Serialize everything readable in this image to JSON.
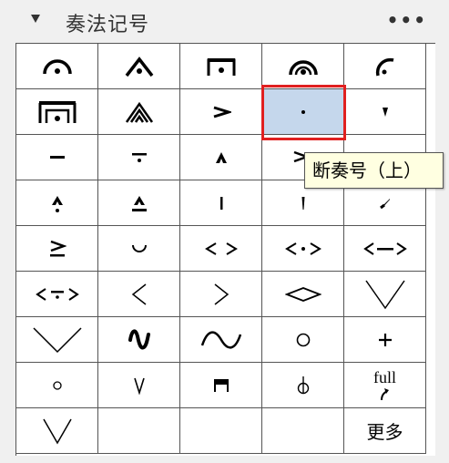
{
  "panel": {
    "title": "奏法记号",
    "more_menu": "•••"
  },
  "grid_cells": [
    {
      "name": "fermata-icon"
    },
    {
      "name": "fermata-triangle-icon"
    },
    {
      "name": "fermata-square-icon"
    },
    {
      "name": "fermata-long-icon"
    },
    {
      "name": "fermata-short-icon"
    },
    {
      "name": "fermata-very-long-icon"
    },
    {
      "name": "fermata-double-triangle-icon"
    },
    {
      "name": "accent-icon"
    },
    {
      "name": "staccato-icon",
      "selected": true
    },
    {
      "name": "staccatissimo-wedge-icon"
    },
    {
      "name": "tenuto-icon"
    },
    {
      "name": "tenuto-staccato-icon"
    },
    {
      "name": "marcato-icon"
    },
    {
      "name": "accent-staccato-icon"
    },
    {
      "name": "accent-small-icon"
    },
    {
      "name": "marcato-staccato-icon"
    },
    {
      "name": "marcato-tenuto-icon"
    },
    {
      "name": "staccatissimo-stroke-icon"
    },
    {
      "name": "staccatissimo-small-icon"
    },
    {
      "name": "staccatissimo-slash-icon"
    },
    {
      "name": "accent-tenuto-icon"
    },
    {
      "name": "breve-icon"
    },
    {
      "name": "messa-di-voce-icon"
    },
    {
      "name": "messa-di-voce-dot-icon"
    },
    {
      "name": "messa-di-voce-line-icon"
    },
    {
      "name": "messa-di-voce-tenuto-icon"
    },
    {
      "name": "crescendo-icon"
    },
    {
      "name": "decrescendo-icon"
    },
    {
      "name": "diamond-dynamics-icon"
    },
    {
      "name": "decrescendo-large-icon"
    },
    {
      "name": "crescendo-large-icon"
    },
    {
      "name": "vibrato-icon"
    },
    {
      "name": "wave-icon"
    },
    {
      "name": "harmonic-circle-icon"
    },
    {
      "name": "stopped-plus-icon"
    },
    {
      "name": "open-circle-small-icon"
    },
    {
      "name": "up-bow-icon"
    },
    {
      "name": "down-bow-icon"
    },
    {
      "name": "thumb-position-icon"
    },
    {
      "name": "full-bend-icon",
      "label": "full"
    },
    {
      "name": "decrescendo-bottom-icon"
    },
    {
      "name": "empty-cell"
    },
    {
      "name": "empty-cell"
    },
    {
      "name": "empty-cell"
    },
    {
      "name": "more-button",
      "label": "更多"
    }
  ],
  "tooltip": {
    "text": "断奏号（上）"
  }
}
